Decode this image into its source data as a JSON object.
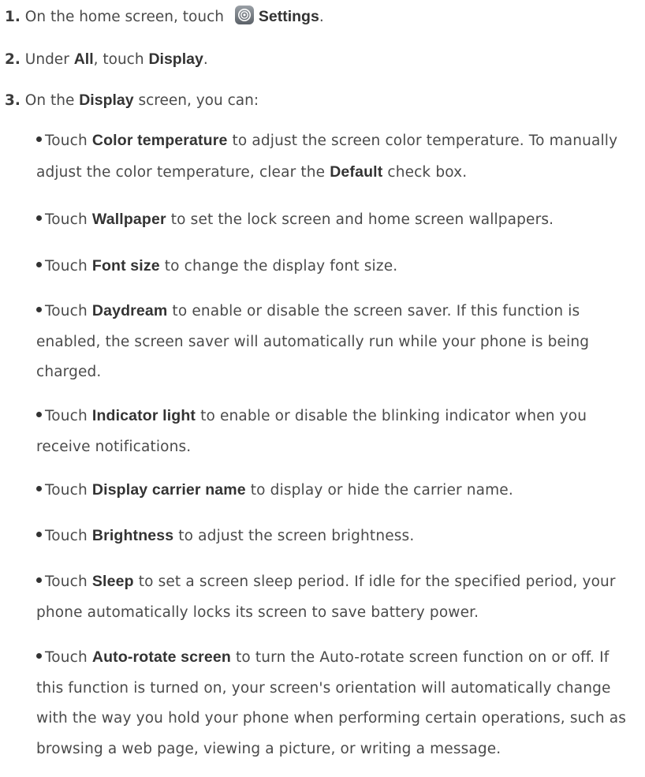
{
  "steps": [
    {
      "number": "1.",
      "parts": [
        "On the home screen, touch ",
        "Settings",
        "."
      ],
      "icon": "settings-gear-icon"
    },
    {
      "number": "2.",
      "parts": [
        "Under ",
        "All",
        ", touch ",
        "Display",
        "."
      ]
    },
    {
      "number": "3.",
      "parts": [
        "On the ",
        "Display",
        " screen, you can:"
      ]
    }
  ],
  "bullets": [
    {
      "pre": "Touch ",
      "term": "Color temperature",
      "mid": " to adjust the screen color temperature. To manually adjust the color temperature, clear the ",
      "term2": "Default",
      "post": " check box."
    },
    {
      "pre": "Touch ",
      "term": "Wallpaper",
      "post": " to set the lock screen and home screen wallpapers."
    },
    {
      "pre": "Touch ",
      "term": "Font size",
      "post": " to change the display font size."
    },
    {
      "pre": "Touch ",
      "term": "Daydream",
      "post": " to enable or disable the screen saver. If this function is enabled, the screen saver will automatically run while your phone is being charged."
    },
    {
      "pre": "Touch ",
      "term": "Indicator light",
      "post": " to enable or disable the blinking indicator when you receive notifications."
    },
    {
      "pre": "Touch ",
      "term": "Display carrier name",
      "post": " to display or hide the carrier name."
    },
    {
      "pre": "Touch ",
      "term": "Brightness",
      "post": " to adjust the screen brightness."
    },
    {
      "pre": "Touch ",
      "term": "Sleep",
      "post": " to set a screen sleep period. If idle for the specified period, your phone automatically locks its screen to save battery power."
    },
    {
      "pre": "Touch ",
      "term": "Auto-rotate screen",
      "post": " to turn the Auto-rotate screen function on or off. If this function is turned on, your screen's orientation will automatically change with the way you hold your phone when performing certain operations, such as browsing a web page, viewing a picture, or writing a message."
    }
  ]
}
